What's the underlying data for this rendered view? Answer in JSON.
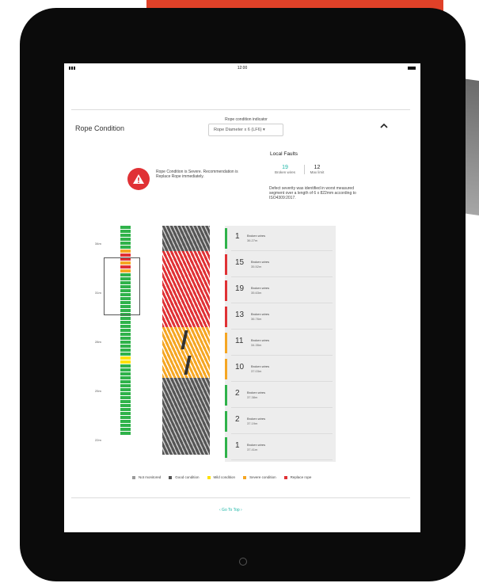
{
  "status_bar": {
    "time": "12:00"
  },
  "rope_condition": {
    "title": "Rope Condition",
    "indicator_label": "Rope condition indicator",
    "selected_diameter": "Rope Diameter x 6 (LF6) ▾",
    "collapse_icon": "chevron-up-icon"
  },
  "warning": {
    "icon": "warning-triangle-icon",
    "text": "Rope Condition is Severe. Recommendation is Replace Rope immediately."
  },
  "local_faults": {
    "title": "Local Faults",
    "broken_wires_value": "19",
    "broken_wires_label": "Broken wires",
    "max_limit_value": "12",
    "max_limit_label": "Max limit",
    "description": "Defect severity was identified in worst measured segment over a length of 6 x 822mm according to ISO4309:2017."
  },
  "axis_ticks": [
    "34m",
    "31m",
    "28m",
    "25m",
    "22m"
  ],
  "health_strip": [
    {
      "state": "good",
      "units": 6
    },
    {
      "state": "severe",
      "units": 1
    },
    {
      "state": "replace",
      "units": 2
    },
    {
      "state": "severe",
      "units": 1
    },
    {
      "state": "replace",
      "units": 1
    },
    {
      "state": "severe",
      "units": 1
    },
    {
      "state": "good",
      "units": 21
    },
    {
      "state": "mild",
      "units": 2
    },
    {
      "state": "good",
      "units": 18
    }
  ],
  "rope_segments": [
    "good",
    "replace",
    "replace",
    "replace",
    "severe",
    "severe",
    "good",
    "good",
    "good"
  ],
  "faults": [
    {
      "count": "1",
      "label": "Broken wires",
      "position": "36.27m",
      "state": "good"
    },
    {
      "count": "15",
      "label": "Broken wires",
      "position": "35.52m",
      "state": "replace"
    },
    {
      "count": "19",
      "label": "Broken wires",
      "position": "35.63m",
      "state": "replace"
    },
    {
      "count": "13",
      "label": "Broken wires",
      "position": "36.76m",
      "state": "replace"
    },
    {
      "count": "11",
      "label": "Broken wires",
      "position": "34.35m",
      "state": "severe"
    },
    {
      "count": "10",
      "label": "Broken wires",
      "position": "37.03m",
      "state": "severe"
    },
    {
      "count": "2",
      "label": "Broken wires",
      "position": "37.38m",
      "state": "good"
    },
    {
      "count": "2",
      "label": "Broken wires",
      "position": "37.19m",
      "state": "good"
    },
    {
      "count": "1",
      "label": "Broken wires",
      "position": "37.41m",
      "state": "good"
    }
  ],
  "legend": [
    {
      "label": "Not monitored",
      "state": "none"
    },
    {
      "label": "Good condition",
      "state": "good_gray"
    },
    {
      "label": "Mild condition",
      "state": "mild"
    },
    {
      "label": "Severe condition",
      "state": "severe"
    },
    {
      "label": "Replace rope",
      "state": "replace"
    }
  ],
  "colors": {
    "good": "#2fb24a",
    "good_gray": "#555555",
    "mild": "#ffe100",
    "severe": "#f5a623",
    "replace": "#e03135",
    "none": "#9a9a9a",
    "accent": "#1bb5a6"
  },
  "go_to_top": "‹ Go To Top ›"
}
